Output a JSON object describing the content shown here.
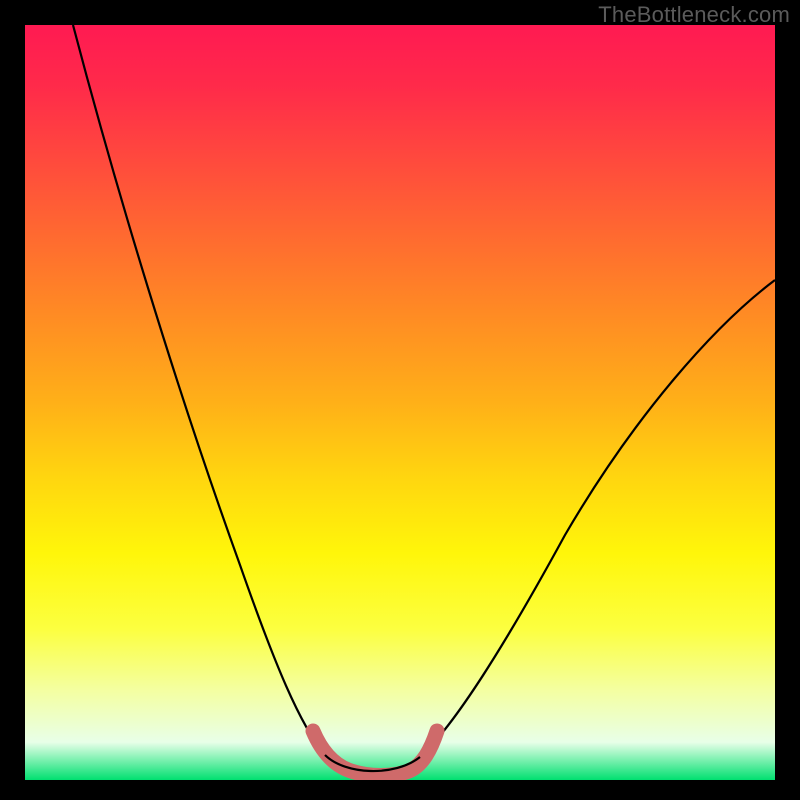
{
  "watermark": "TheBottleneck.com",
  "chart_data": {
    "type": "line",
    "title": "",
    "xlabel": "",
    "ylabel": "",
    "xlim": [
      0,
      100
    ],
    "ylim": [
      0,
      100
    ],
    "grid": false,
    "series": [
      {
        "name": "bottleneck-curve",
        "x": [
          6,
          10,
          14,
          18,
          22,
          26,
          29,
          32,
          34,
          36,
          38,
          40,
          42,
          44,
          46,
          48,
          52,
          56,
          60,
          66,
          72,
          78,
          84,
          90,
          96,
          100
        ],
        "values": [
          100,
          90,
          80,
          70,
          60,
          50,
          42,
          34,
          28,
          22,
          16,
          10,
          5,
          1,
          0,
          0,
          0,
          3,
          8,
          16,
          25,
          34,
          43,
          52,
          60,
          66
        ]
      }
    ],
    "highlight": {
      "name": "trough-band",
      "color": "#cf6a6a",
      "x_range": [
        38,
        54
      ],
      "y_approx": 0
    },
    "gradient_stops": [
      {
        "pos": 0,
        "color": "#ff1a52"
      },
      {
        "pos": 50,
        "color": "#ffb018"
      },
      {
        "pos": 70,
        "color": "#fff60a"
      },
      {
        "pos": 95,
        "color": "#e8ffe8"
      },
      {
        "pos": 100,
        "color": "#00e070"
      }
    ]
  }
}
